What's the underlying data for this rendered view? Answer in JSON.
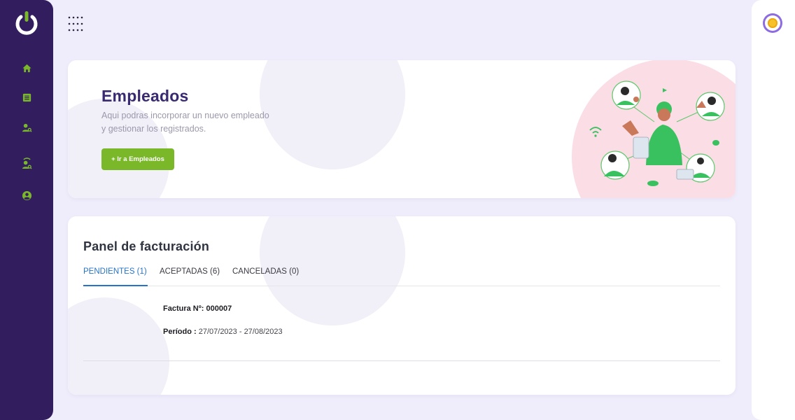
{
  "sidebar": {
    "items": [
      {
        "icon": "home-icon"
      },
      {
        "icon": "list-icon"
      },
      {
        "icon": "user-search-icon"
      },
      {
        "icon": "user-search-signal-icon"
      },
      {
        "icon": "account-circle-icon"
      }
    ]
  },
  "employees_card": {
    "title": "Empleados",
    "description": "Aqui podras incorporar un nuevo empleado y gestionar los registrados.",
    "button_label": "+ Ir a Empleados"
  },
  "billing_panel": {
    "title": "Panel de facturación",
    "tabs": [
      {
        "label": "PENDIENTES (1)",
        "active": true
      },
      {
        "label": "ACEPTADAS (6)",
        "active": false
      },
      {
        "label": "CANCELADAS (0)",
        "active": false
      }
    ],
    "invoice": {
      "number_label": "Factura Nº:",
      "number_value": "000007",
      "period_label": "Período :",
      "period_value": "27/07/2023 - 27/08/2023"
    }
  },
  "colors": {
    "sidebar": "#321e5e",
    "accent_green": "#7ab82a",
    "title_purple": "#3a2a72",
    "tab_active": "#2674c9"
  }
}
